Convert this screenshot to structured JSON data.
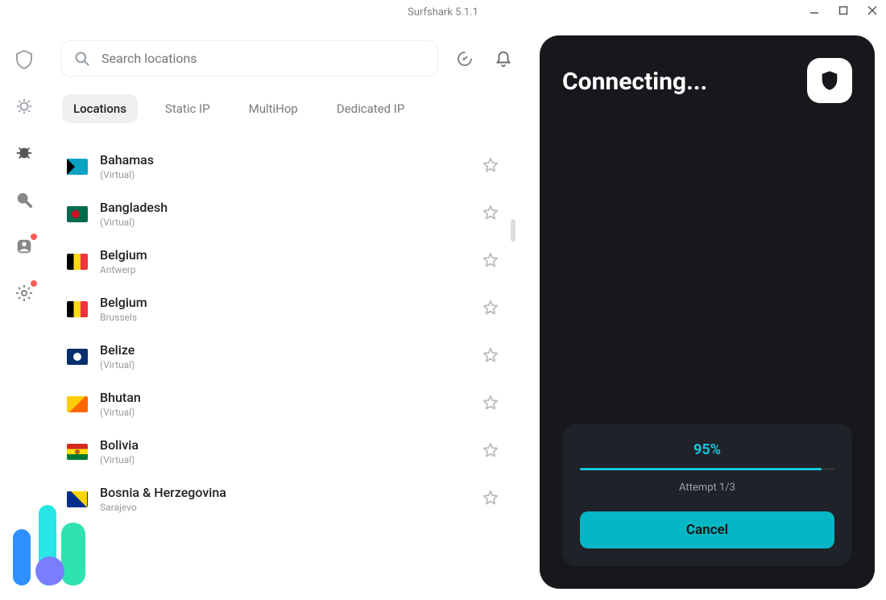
{
  "window": {
    "title": "Surfshark 5.1.1"
  },
  "search": {
    "placeholder": "Search locations"
  },
  "tabs": [
    "Locations",
    "Static IP",
    "MultiHop",
    "Dedicated IP"
  ],
  "locations": [
    {
      "name": "Bahamas",
      "sub": "(Virtual)",
      "flag": "bhs"
    },
    {
      "name": "Bangladesh",
      "sub": "(Virtual)",
      "flag": "bgd"
    },
    {
      "name": "Belgium",
      "sub": "Antwerp",
      "flag": "bel"
    },
    {
      "name": "Belgium",
      "sub": "Brussels",
      "flag": "bel"
    },
    {
      "name": "Belize",
      "sub": "(Virtual)",
      "flag": "blz"
    },
    {
      "name": "Bhutan",
      "sub": "(Virtual)",
      "flag": "btn"
    },
    {
      "name": "Bolivia",
      "sub": "(Virtual)",
      "flag": "bol"
    },
    {
      "name": "Bosnia & Herzegovina",
      "sub": "Sarajevo",
      "flag": "bih"
    }
  ],
  "panel": {
    "title": "Connecting...",
    "percent": "95%",
    "progress_width": "95%",
    "attempt": "Attempt 1/3",
    "cancel": "Cancel"
  }
}
